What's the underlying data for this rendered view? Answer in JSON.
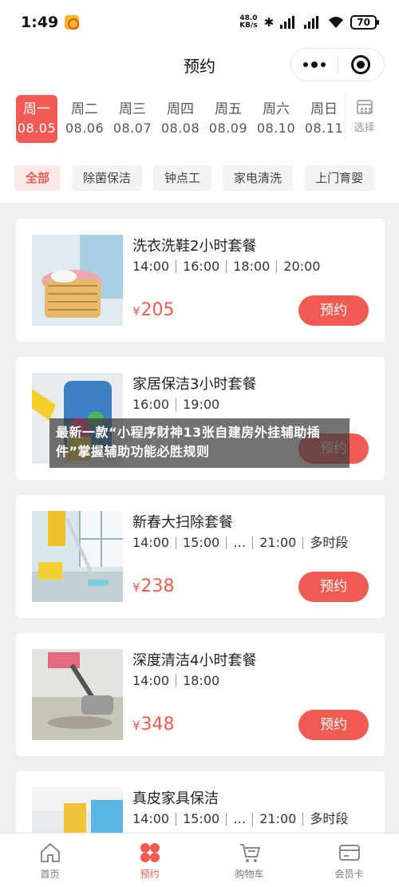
{
  "status": {
    "time": "1:49",
    "speed_top": "48.0",
    "speed_bottom": "KB/s",
    "battery": "70",
    "icons": [
      "bluetooth-icon",
      "signal-icon",
      "wifi-icon"
    ]
  },
  "nav": {
    "title": "预约"
  },
  "dates": [
    {
      "day": "周一",
      "date": "08.05"
    },
    {
      "day": "周二",
      "date": "08.06"
    },
    {
      "day": "周三",
      "date": "08.07"
    },
    {
      "day": "周四",
      "date": "08.08"
    },
    {
      "day": "周五",
      "date": "08.09"
    },
    {
      "day": "周六",
      "date": "08.10"
    },
    {
      "day": "周日",
      "date": "08.11"
    }
  ],
  "date_select_label": "选择",
  "categories": [
    "全部",
    "除菌保洁",
    "钟点工",
    "家电清洗",
    "上门育婴"
  ],
  "cards": [
    {
      "title": "洗衣洗鞋2小时套餐",
      "times": [
        "14:00",
        "16:00",
        "18:00",
        "20:00"
      ],
      "price_symbol": "¥",
      "price": "205",
      "button": "预约"
    },
    {
      "title": "家居保洁3小时套餐",
      "times": [
        "16:00",
        "19:00"
      ],
      "price_symbol": "",
      "price": "",
      "button": "预约"
    },
    {
      "title": "新春大扫除套餐",
      "times": [
        "14:00",
        "15:00",
        "…",
        "21:00",
        "多时段"
      ],
      "price_symbol": "¥",
      "price": "238",
      "button": "预约"
    },
    {
      "title": "深度清洁4小时套餐",
      "times": [
        "14:00",
        "18:00"
      ],
      "price_symbol": "¥",
      "price": "348",
      "button": "预约"
    },
    {
      "title": "真皮家具保洁",
      "times": [
        "14:00",
        "15:00",
        "…",
        "21:00",
        "多时段"
      ],
      "price_symbol": "",
      "price": "",
      "button": ""
    }
  ],
  "overlay_text": "最新一款“小程序财神13张自建房外挂辅助插件”掌握辅助功能必胜规则",
  "tabs": [
    {
      "label": "首页",
      "icon": "home-icon"
    },
    {
      "label": "预约",
      "icon": "grid-icon"
    },
    {
      "label": "购物车",
      "icon": "cart-icon"
    },
    {
      "label": "会员卡",
      "icon": "card-icon"
    }
  ],
  "colors": {
    "accent": "#f05c53",
    "chip_active_bg": "#fde8e6"
  }
}
